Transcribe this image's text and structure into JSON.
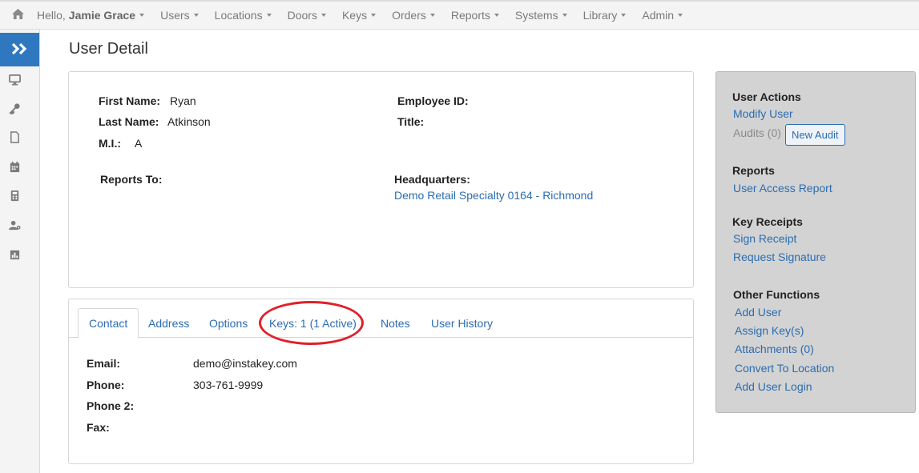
{
  "topnav": {
    "hello_prefix": "Hello,",
    "user_name": "Jamie Grace",
    "menus": [
      "Users",
      "Locations",
      "Doors",
      "Keys",
      "Orders",
      "Reports",
      "Systems",
      "Library",
      "Admin"
    ]
  },
  "page": {
    "title": "User Detail"
  },
  "detail": {
    "first_name_label": "First Name:",
    "first_name": "Ryan",
    "last_name_label": "Last Name:",
    "last_name": "Atkinson",
    "mi_label": "M.I.:",
    "mi": "A",
    "employee_id_label": "Employee ID:",
    "title_label": "Title:",
    "reports_to_label": "Reports To:",
    "headquarters_label": "Headquarters:",
    "headquarters": "Demo Retail Specialty 0164 - Richmond"
  },
  "tabs": {
    "items": [
      "Contact",
      "Address",
      "Options",
      "Keys: 1 (1 Active)",
      "Notes",
      "User History"
    ],
    "active": "Contact"
  },
  "contact": {
    "email_label": "Email:",
    "email": "demo@instakey.com",
    "phone_label": "Phone:",
    "phone": "303-761-9999",
    "phone2_label": "Phone 2:",
    "fax_label": "Fax:"
  },
  "actions": {
    "user_actions_heading": "User Actions",
    "modify_user": "Modify User",
    "audits": "Audits (0)",
    "new_audit": "New Audit",
    "reports_heading": "Reports",
    "user_access_report": "User Access Report",
    "key_receipts_heading": "Key Receipts",
    "sign_receipt": "Sign Receipt",
    "request_signature": "Request Signature",
    "other_functions_heading": "Other Functions",
    "add_user": "Add User",
    "assign_keys": "Assign Key(s)",
    "attachments": "Attachments (0)",
    "convert_to_location": "Convert To Location",
    "add_user_login": "Add User Login"
  },
  "colors": {
    "accent": "#2f78c0",
    "link": "#2b6cb0",
    "highlight": "#e0202a",
    "panel": "#d3d3d3"
  },
  "icons": {
    "home": "home-icon",
    "sidebar": [
      "double-chevron-right-icon",
      "monitor-icon",
      "key-icon",
      "document-icon",
      "calendar-icon",
      "calculator-icon",
      "user-gear-icon",
      "bar-chart-icon"
    ]
  }
}
